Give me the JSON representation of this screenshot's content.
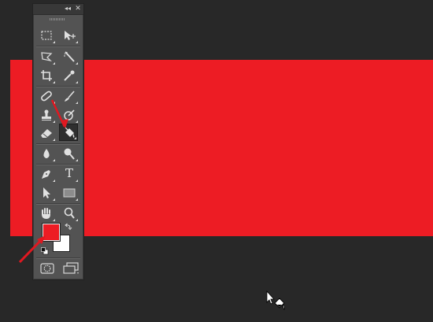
{
  "colors": {
    "background": "#282828",
    "layer_fill": "#ed1c24",
    "foreground_color": "#ed1c24",
    "background_color": "#ffffff",
    "annotation_arrow": "#e01820"
  },
  "panel": {
    "name": "tools",
    "collapse_glyph": "◂◂",
    "close_glyph": "✕"
  },
  "tools": [
    {
      "icon": "rectangular-marquee-icon",
      "active": false
    },
    {
      "icon": "move-icon",
      "active": false
    },
    {
      "icon": "lasso-icon",
      "active": false
    },
    {
      "icon": "magic-wand-icon",
      "active": false
    },
    {
      "icon": "crop-icon",
      "active": false
    },
    {
      "icon": "eyedropper-icon",
      "active": false
    },
    {
      "icon": "spot-healing-brush-icon",
      "active": false
    },
    {
      "icon": "brush-icon",
      "active": false
    },
    {
      "icon": "clone-stamp-icon",
      "active": false
    },
    {
      "icon": "history-brush-icon",
      "active": false
    },
    {
      "icon": "eraser-icon",
      "active": false
    },
    {
      "icon": "paint-bucket-icon",
      "active": true
    },
    {
      "icon": "blur-icon",
      "active": false
    },
    {
      "icon": "dodge-icon",
      "active": false
    },
    {
      "icon": "pen-icon",
      "active": false
    },
    {
      "icon": "type-icon",
      "active": false
    },
    {
      "icon": "path-selection-icon",
      "active": false
    },
    {
      "icon": "rectangle-shape-icon",
      "active": false
    },
    {
      "icon": "hand-icon",
      "active": false
    },
    {
      "icon": "zoom-icon",
      "active": false
    }
  ],
  "type_tool_glyph": "T",
  "cursor_icon": "paint-bucket-cursor-icon"
}
